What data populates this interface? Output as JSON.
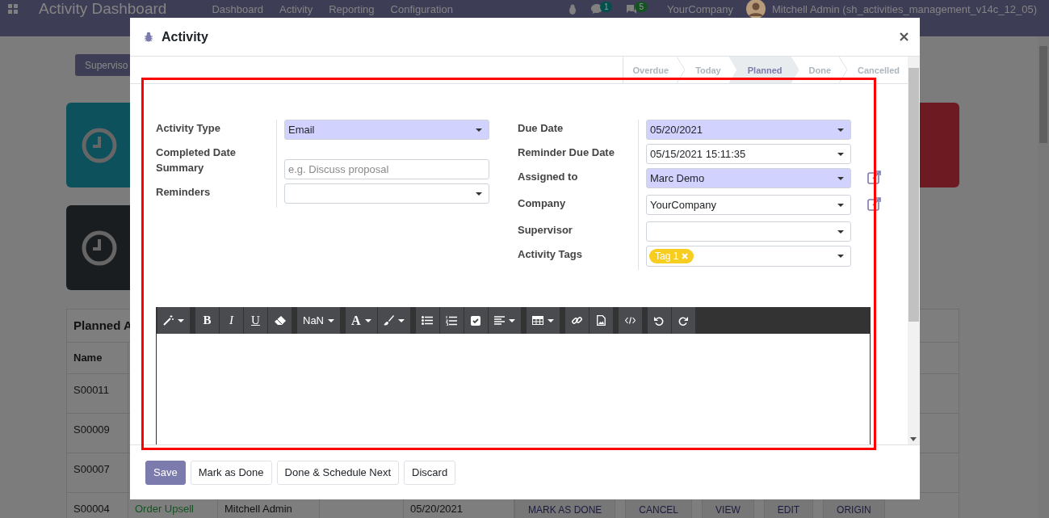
{
  "navbar": {
    "app_title": "Activity Dashboard",
    "menu": [
      "Dashboard",
      "Activity",
      "Reporting",
      "Configuration"
    ],
    "badges": [
      {
        "kind": "chat",
        "count": "1",
        "color": "#00504e"
      },
      {
        "kind": "message",
        "count": "5",
        "color": "#145422"
      }
    ],
    "company": "YourCompany",
    "user": "Mitchell Admin (sh_activities_management_v14c_12_05)"
  },
  "background": {
    "filter_button": "Superviso",
    "cards": [
      {
        "color": "#0c515c"
      },
      {
        "color": "#1a1d20"
      },
      {
        "color": "#6e1a22"
      }
    ],
    "table": {
      "title": "Planned A",
      "columns": [
        "Name"
      ],
      "rows": [
        {
          "name": "S00011"
        },
        {
          "name": "S00009"
        },
        {
          "name": "S00007"
        },
        {
          "name": "S00004",
          "column_2": "Order Upsell",
          "column_3": "Mitchell Admin",
          "column_5": "05/20/2021",
          "actions": [
            "MARK AS DONE",
            "CANCEL",
            "VIEW",
            "EDIT",
            "ORIGIN"
          ]
        }
      ]
    }
  },
  "dialog": {
    "title": "Activity",
    "stages": [
      {
        "label": "Overdue",
        "selected": false
      },
      {
        "label": "Today",
        "selected": false
      },
      {
        "label": "Planned",
        "selected": true
      },
      {
        "label": "Done",
        "selected": false
      },
      {
        "label": "Cancelled",
        "selected": false
      }
    ],
    "left_fields": [
      {
        "label": "Activity Type",
        "kind": "select",
        "value": "Email",
        "required": true
      },
      {
        "label": "Completed Date",
        "kind": "none"
      },
      {
        "label": "Summary",
        "kind": "text",
        "placeholder": "e.g. Discuss proposal"
      },
      {
        "label": "Reminders",
        "kind": "select",
        "required": false
      }
    ],
    "right_fields": [
      {
        "label": "Due Date",
        "kind": "select",
        "value": "05/20/2021",
        "required": true
      },
      {
        "label": "Reminder Due Date",
        "kind": "select",
        "value": "05/15/2021 15:11:35",
        "required": false
      },
      {
        "label": "Assigned to",
        "kind": "select",
        "value": "Marc Demo",
        "required": true,
        "link": true
      },
      {
        "label": "Company",
        "kind": "select",
        "value": "YourCompany",
        "required": false,
        "link": true
      },
      {
        "label": "Supervisor",
        "kind": "select",
        "required": false
      },
      {
        "label": "Activity Tags",
        "kind": "tags",
        "tags": [
          {
            "label": "Tag 1",
            "color": "#f7cd1f"
          }
        ]
      }
    ],
    "toolbar": [
      [
        {
          "kind": "wand",
          "caret": true
        }
      ],
      [
        {
          "kind": "bold",
          "text": "B"
        },
        {
          "kind": "italic",
          "text": "I"
        },
        {
          "kind": "underline",
          "text": "U"
        },
        {
          "kind": "eraser"
        }
      ],
      [
        {
          "kind": "size",
          "text": "NaN",
          "caret": true
        }
      ],
      [
        {
          "kind": "color",
          "text": "A",
          "caret": true
        },
        {
          "kind": "brush",
          "caret": true
        }
      ],
      [
        {
          "kind": "bullets"
        },
        {
          "kind": "numbers"
        },
        {
          "kind": "check"
        },
        {
          "kind": "align",
          "caret": true
        }
      ],
      [
        {
          "kind": "table",
          "caret": true
        }
      ],
      [
        {
          "kind": "link"
        },
        {
          "kind": "image"
        }
      ],
      [
        {
          "kind": "code"
        }
      ],
      [
        {
          "kind": "undo"
        },
        {
          "kind": "redo"
        }
      ]
    ],
    "buttons": [
      {
        "label": "Save",
        "primary": true
      },
      {
        "label": "Mark as Done",
        "primary": false
      },
      {
        "label": "Done & Schedule Next",
        "primary": false
      },
      {
        "label": "Discard",
        "primary": false
      }
    ]
  }
}
